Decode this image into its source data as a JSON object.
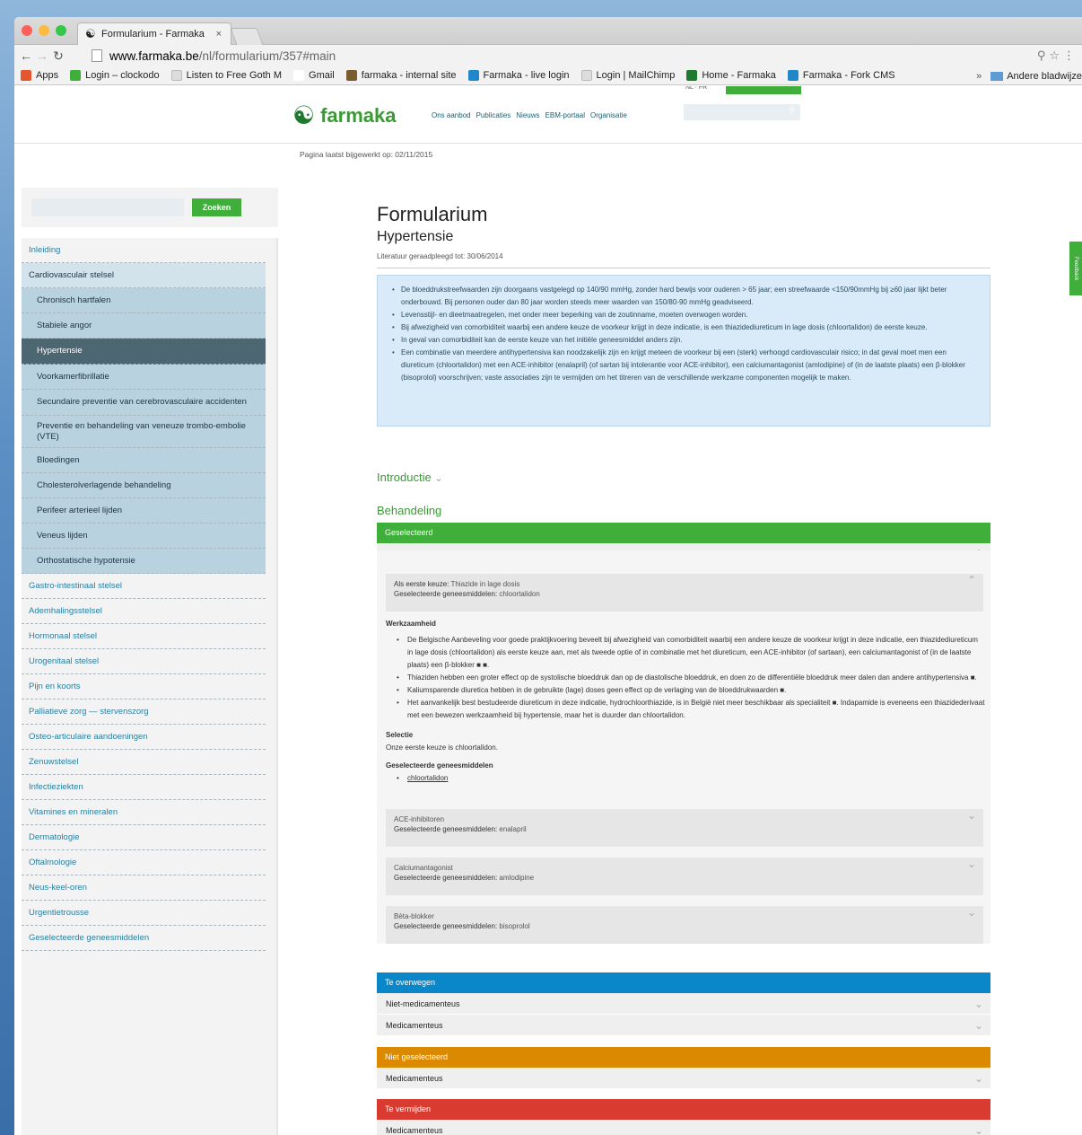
{
  "browser": {
    "tab_title": "Formularium - Farmaka",
    "tab_close": "×",
    "url_domain": "www.farmaka.be",
    "url_path": "/nl/formularium/357#main",
    "bookmarks": [
      {
        "label": "Apps"
      },
      {
        "label": "Login – clockodo"
      },
      {
        "label": "Listen to Free Goth M"
      },
      {
        "label": "Gmail"
      },
      {
        "label": "farmaka - internal site"
      },
      {
        "label": "Farmaka - live login"
      },
      {
        "label": "Login | MailChimp"
      },
      {
        "label": "Home - Farmaka"
      },
      {
        "label": "Farmaka - Fork CMS"
      }
    ],
    "bookmarks_more": "»",
    "other_bookmarks": "Andere bladwijze"
  },
  "site": {
    "logo_text": "farmaka",
    "nav": [
      "Ons aanbod",
      "Publicaties",
      "Nieuws",
      "EBM-portaal",
      "Organisatie"
    ],
    "updated": "Pagina laatst bijgewerkt op: 02/11/2015",
    "feedback": "Feedback"
  },
  "sidebar": {
    "search_button": "Zoeken",
    "items": [
      {
        "label": "Inleiding",
        "type": "top"
      },
      {
        "label": "Cardiovasculair stelsel",
        "type": "cat"
      },
      {
        "label": "Chronisch hartfalen",
        "type": "sub"
      },
      {
        "label": "Stabiele angor",
        "type": "sub"
      },
      {
        "label": "Hypertensie",
        "type": "active"
      },
      {
        "label": "Voorkamerfibrillatie",
        "type": "sub"
      },
      {
        "label": "Secundaire preventie van cerebrovasculaire accidenten",
        "type": "sub"
      },
      {
        "label": "Preventie en behandeling van veneuze trombo-embolie (VTE)",
        "type": "sub2"
      },
      {
        "label": "Bloedingen",
        "type": "sub"
      },
      {
        "label": "Cholesterolverlagende behandeling",
        "type": "sub"
      },
      {
        "label": "Perifeer arterieel lijden",
        "type": "sub"
      },
      {
        "label": "Veneus lijden",
        "type": "sub"
      },
      {
        "label": "Orthostatische hypotensie",
        "type": "sub"
      },
      {
        "label": "Gastro-intestinaal stelsel",
        "type": "top"
      },
      {
        "label": "Ademhalingsstelsel",
        "type": "top"
      },
      {
        "label": "Hormonaal stelsel",
        "type": "top"
      },
      {
        "label": "Urogenitaal stelsel",
        "type": "top"
      },
      {
        "label": "Pijn en koorts",
        "type": "top"
      },
      {
        "label": "Palliatieve zorg — stervenszorg",
        "type": "top"
      },
      {
        "label": "Osteo-articulaire aandoeningen",
        "type": "top"
      },
      {
        "label": "Zenuwstelsel",
        "type": "top"
      },
      {
        "label": "Infectieziekten",
        "type": "top"
      },
      {
        "label": "Vitamines en mineralen",
        "type": "top"
      },
      {
        "label": "Dermatologie",
        "type": "top"
      },
      {
        "label": "Oftalmologie",
        "type": "top"
      },
      {
        "label": "Neus-keel-oren",
        "type": "top"
      },
      {
        "label": "Urgentietrousse",
        "type": "top"
      },
      {
        "label": "Geselecteerde geneesmiddelen",
        "type": "top"
      }
    ]
  },
  "main": {
    "title": "Formularium",
    "subtitle": "Hypertensie",
    "literature": "Literatuur geraadpleegd tot: 30/06/2014",
    "summary": [
      "De bloeddrukstreefwaarden zijn doorgaans vastgelegd op 140/90 mmHg, zonder hard bewijs voor ouderen > 65 jaar; een streefwaarde <150/90mmHg bij ≥60 jaar lijkt beter onderbouwd. Bij personen ouder dan 80 jaar worden steeds meer waarden van 150/80-90 mmHg geadviseerd.",
      "Levensstijl- en dieetmaatregelen, met onder meer beperking van de zoutinname, moeten overwogen worden.",
      "Bij afwezigheid van comorbiditeit waarbij een andere keuze de voorkeur krijgt in deze indicatie, is een thiazidediureticum in lage dosis (chloortalidon) de eerste keuze.",
      "In geval van comorbiditeit kan de eerste keuze van het initiële geneesmiddel anders zijn.",
      "Een combinatie van meerdere antihypertensiva kan noodzakelijk zijn en krijgt meteen de voorkeur bij een (sterk) verhoogd cardiovasculair risico; in dat geval moet men een diureticum (chloortalidon) met een ACE-inhibitor (enalapril) (of sartan bij intolerantie voor ACE-inhibitor), een calciumantagonist (amlodipine) of (in de laatste plaats) een β-blokker (bisoprolol) voorschrijven; vaste associaties zijn te vermijden om het titreren van de verschillende werkzame componenten mogelijk te maken."
    ],
    "intro_label": "Introductie",
    "behandeling_label": "Behandeling",
    "selected_bar": "Geselecteerd",
    "medicamenteus": "Medicamenteus",
    "first_choice_label": "Als eerste keuze:",
    "first_choice_value": "Thiazide in lage dosis",
    "selected_drugs_label": "Geselecteerde geneesmiddelen:",
    "first_choice_drug": "chloortalidon",
    "werkzaamheid_title": "Werkzaamheid",
    "werkzaamheid": [
      "De Belgische Aanbeveling voor goede praktijkvoering beveelt bij afwezigheid van comorbiditeit waarbij een andere keuze de voorkeur krijgt in deze indicatie, een thiazidediureticum in lage dosis (chloortalidon) als eerste keuze aan, met als tweede optie of in combinatie met het diureticum, een ACE-inhibitor (of sartaan), een calciumantagonist of (in de laatste plaats) een β-blokker ■ ■.",
      "Thiaziden hebben een groter effect op de systolische bloeddruk dan op de diastolische bloeddruk, en doen zo de differentiële bloeddruk meer dalen dan andere antihypertensiva ■.",
      "Kaliumsparende diuretica hebben in de gebruikte (lage) doses geen effect op de verlaging van de bloeddrukwaarden ■.",
      "Het aanvankelijk best bestudeerde diureticum in deze indicatie, hydrochloorthiazide, is in België niet meer beschikbaar als specialiteit ■. Indapamide is eveneens een thiazidederivaat met een bewezen werkzaamheid bij hypertensie, maar het is duurder dan chloortalidon."
    ],
    "selectie_title": "Selectie",
    "selectie_text": "Onze eerste keuze is chloortalidon.",
    "selected_drugs_title": "Geselecteerde geneesmiddelen",
    "selected_drug_link": "chloortalidon",
    "options": [
      {
        "name": "ACE-inhibitoren",
        "drug": "enalapril"
      },
      {
        "name": "Calciumantagonist",
        "drug": "amlodipine"
      },
      {
        "name": "Bèta-blokker",
        "drug": "bisoprolol"
      }
    ],
    "te_overwegen": "Te overwegen",
    "niet_medicamenteus": "Niet-medicamenteus",
    "niet_geselecteerd": "Niet geselecteerd",
    "te_vermijden": "Te vermijden",
    "colors": {
      "green": "#3fae3a",
      "blue": "#0a87c8",
      "orange": "#db8a00",
      "red": "#d93b30"
    }
  }
}
